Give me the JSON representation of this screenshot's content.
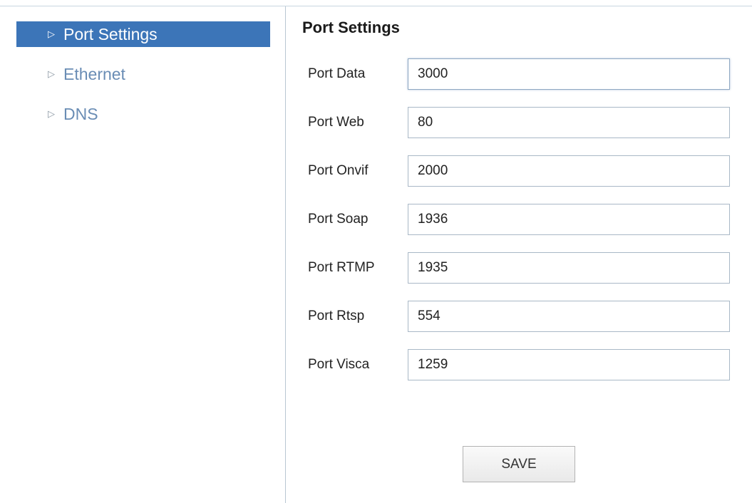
{
  "sidebar": {
    "items": [
      {
        "label": "Port Settings",
        "active": true
      },
      {
        "label": "Ethernet",
        "active": false
      },
      {
        "label": "DNS",
        "active": false
      }
    ]
  },
  "main": {
    "title": "Port Settings",
    "fields": [
      {
        "label": "Port Data",
        "value": "3000"
      },
      {
        "label": "Port Web",
        "value": "80"
      },
      {
        "label": "Port Onvif",
        "value": "2000"
      },
      {
        "label": "Port Soap",
        "value": "1936"
      },
      {
        "label": "Port RTMP",
        "value": "1935"
      },
      {
        "label": "Port Rtsp",
        "value": "554"
      },
      {
        "label": "Port Visca",
        "value": "1259"
      }
    ],
    "save_label": "SAVE"
  },
  "colors": {
    "accent": "#3c75b8",
    "link": "#6a8db5"
  },
  "icons": {
    "nav_arrow": "triangle-right-icon"
  }
}
